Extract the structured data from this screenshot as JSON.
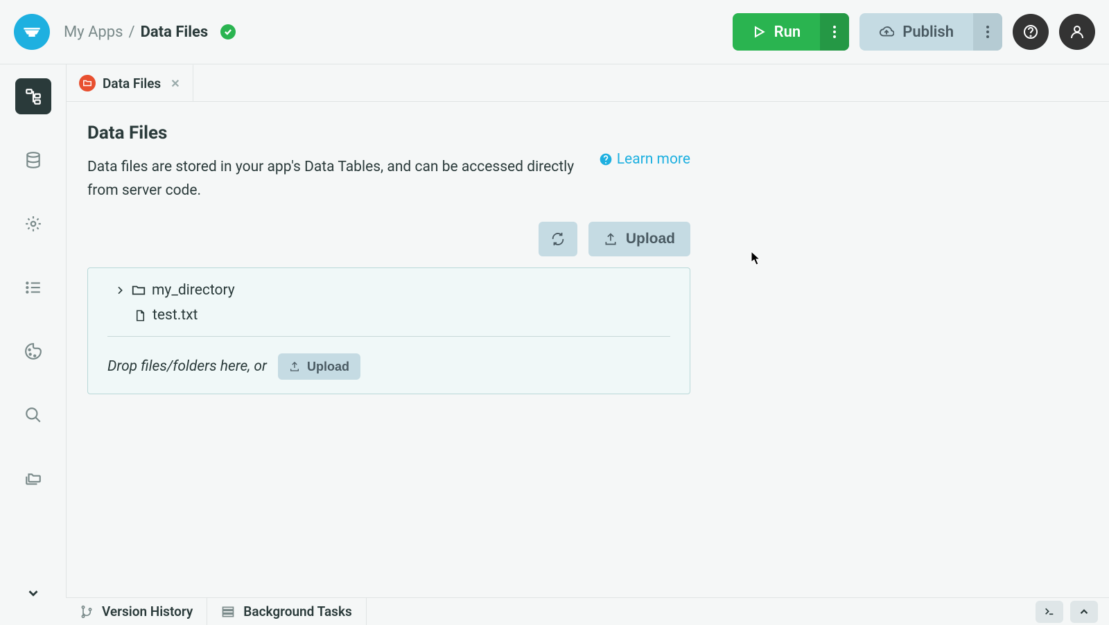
{
  "header": {
    "breadcrumb_parent": "My Apps",
    "breadcrumb_current": "Data Files",
    "run_label": "Run",
    "publish_label": "Publish"
  },
  "tab": {
    "label": "Data Files"
  },
  "content": {
    "title": "Data Files",
    "subtitle": "Data files are stored in your app's Data Tables, and can be accessed directly from server code.",
    "learn_more": "Learn more",
    "upload_label": "Upload",
    "upload_small_label": "Upload",
    "drop_text": "Drop files/folders here, or",
    "files": {
      "directory": "my_directory",
      "file": "test.txt"
    }
  },
  "footer": {
    "version_history": "Version History",
    "background_tasks": "Background Tasks"
  }
}
